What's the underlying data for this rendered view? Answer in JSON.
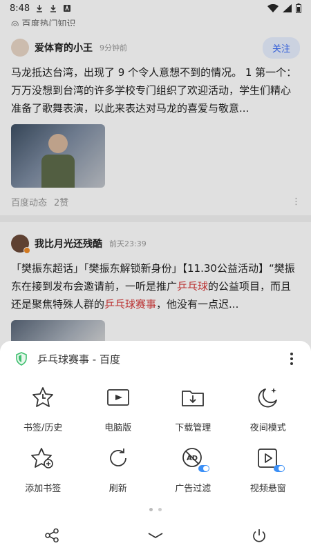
{
  "status": {
    "time": "8:48"
  },
  "feed": {
    "cutoff_text": "◎ 百度热门知识",
    "posts": [
      {
        "author": "爱体育的小王",
        "time": "9分钟前",
        "follow_label": "关注",
        "text": "马龙抵达台湾，出现了 9 个令人意想不到的情况。 1 第一个：万万没想到台湾的许多学校专门组织了欢迎活动，学生们精心准备了歌舞表演，以此来表达对马龙的喜爱与敬意...",
        "meta_source": "百度动态",
        "meta_likes": "2赞",
        "more": "⋮"
      },
      {
        "author": "我比月光还残酷",
        "time": "前天23:39",
        "text_parts": {
          "p1": "「樊振东超话」「樊振东解锁新身份」【11.30公益活动】“樊振东在接到发布会邀请前，一听是推广",
          "hl1": "乒乓球",
          "p2": "的公益项目，而且还是聚焦特殊人群的",
          "hl2": "乒乓球赛事",
          "p3": "，他没有一点迟..."
        }
      }
    ]
  },
  "sheet": {
    "title": "乒乓球赛事 - 百度",
    "items": [
      {
        "label": "书签/历史",
        "icon": "bookmark-history-icon"
      },
      {
        "label": "电脑版",
        "icon": "desktop-version-icon"
      },
      {
        "label": "下载管理",
        "icon": "download-manager-icon"
      },
      {
        "label": "夜间模式",
        "icon": "night-mode-icon"
      },
      {
        "label": "添加书签",
        "icon": "add-bookmark-icon"
      },
      {
        "label": "刷新",
        "icon": "refresh-icon"
      },
      {
        "label": "广告过滤",
        "icon": "ad-block-icon"
      },
      {
        "label": "视频悬窗",
        "icon": "video-float-icon"
      }
    ],
    "colors": {
      "accent": "#3b8ff6",
      "shield": "#3fbf6f"
    }
  }
}
